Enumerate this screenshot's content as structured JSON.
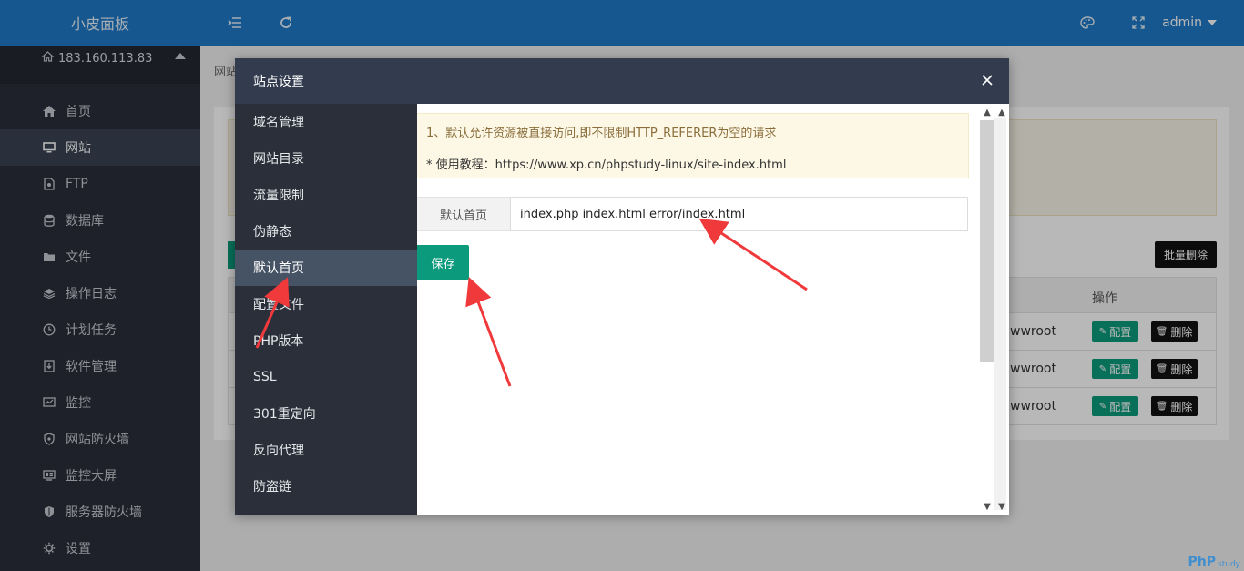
{
  "app": {
    "brand": "小皮面板",
    "server_ip": "183.160.113.83",
    "user": "admin"
  },
  "sidebar": {
    "items": [
      {
        "label": "首页",
        "icon": "home-icon"
      },
      {
        "label": "网站",
        "icon": "monitor-icon",
        "active": true
      },
      {
        "label": "FTP",
        "icon": "ftp-icon"
      },
      {
        "label": "数据库",
        "icon": "database-icon"
      },
      {
        "label": "文件",
        "icon": "folder-icon"
      },
      {
        "label": "操作日志",
        "icon": "layers-icon"
      },
      {
        "label": "计划任务",
        "icon": "clock-icon"
      },
      {
        "label": "软件管理",
        "icon": "download-icon"
      },
      {
        "label": "监控",
        "icon": "chart-icon"
      },
      {
        "label": "网站防火墙",
        "icon": "shield-icon"
      },
      {
        "label": "监控大屏",
        "icon": "screen-icon"
      },
      {
        "label": "服务器防火墙",
        "icon": "shield-lock-icon"
      },
      {
        "label": "设置",
        "icon": "gear-icon"
      }
    ]
  },
  "background": {
    "breadcrumb": "网站",
    "batch_delete": "批量删除",
    "table": {
      "op_header": "操作",
      "rows": [
        {
          "path": "wwroot",
          "config": "配置",
          "delete": "删除"
        },
        {
          "path": "wwroot",
          "config": "配置",
          "delete": "删除"
        },
        {
          "path": "wwroot",
          "config": "配置",
          "delete": "删除"
        }
      ]
    }
  },
  "modal": {
    "title": "站点设置",
    "nav": [
      {
        "label": "域名管理"
      },
      {
        "label": "网站目录"
      },
      {
        "label": "流量限制"
      },
      {
        "label": "伪静态"
      },
      {
        "label": "默认首页",
        "active": true
      },
      {
        "label": "配置文件"
      },
      {
        "label": "PHP版本"
      },
      {
        "label": "SSL"
      },
      {
        "label": "301重定向"
      },
      {
        "label": "反向代理"
      },
      {
        "label": "防盗链"
      }
    ],
    "tip_line1": "1、默认允许资源被直接访问,即不限制HTTP_REFERER为空的请求",
    "tip_line2": "* 使用教程：https://www.xp.cn/phpstudy-linux/site-index.html",
    "field_label": "默认首页",
    "field_value": "index.php index.html error/index.html",
    "save_label": "保存"
  },
  "colors": {
    "topbar": "#1f79c6",
    "sidebar": "#2a2f3a",
    "primary_button": "#0c9a7c",
    "annotation_arrow": "#f0393b"
  },
  "watermark": {
    "main": "PhP",
    "sub": "study"
  }
}
